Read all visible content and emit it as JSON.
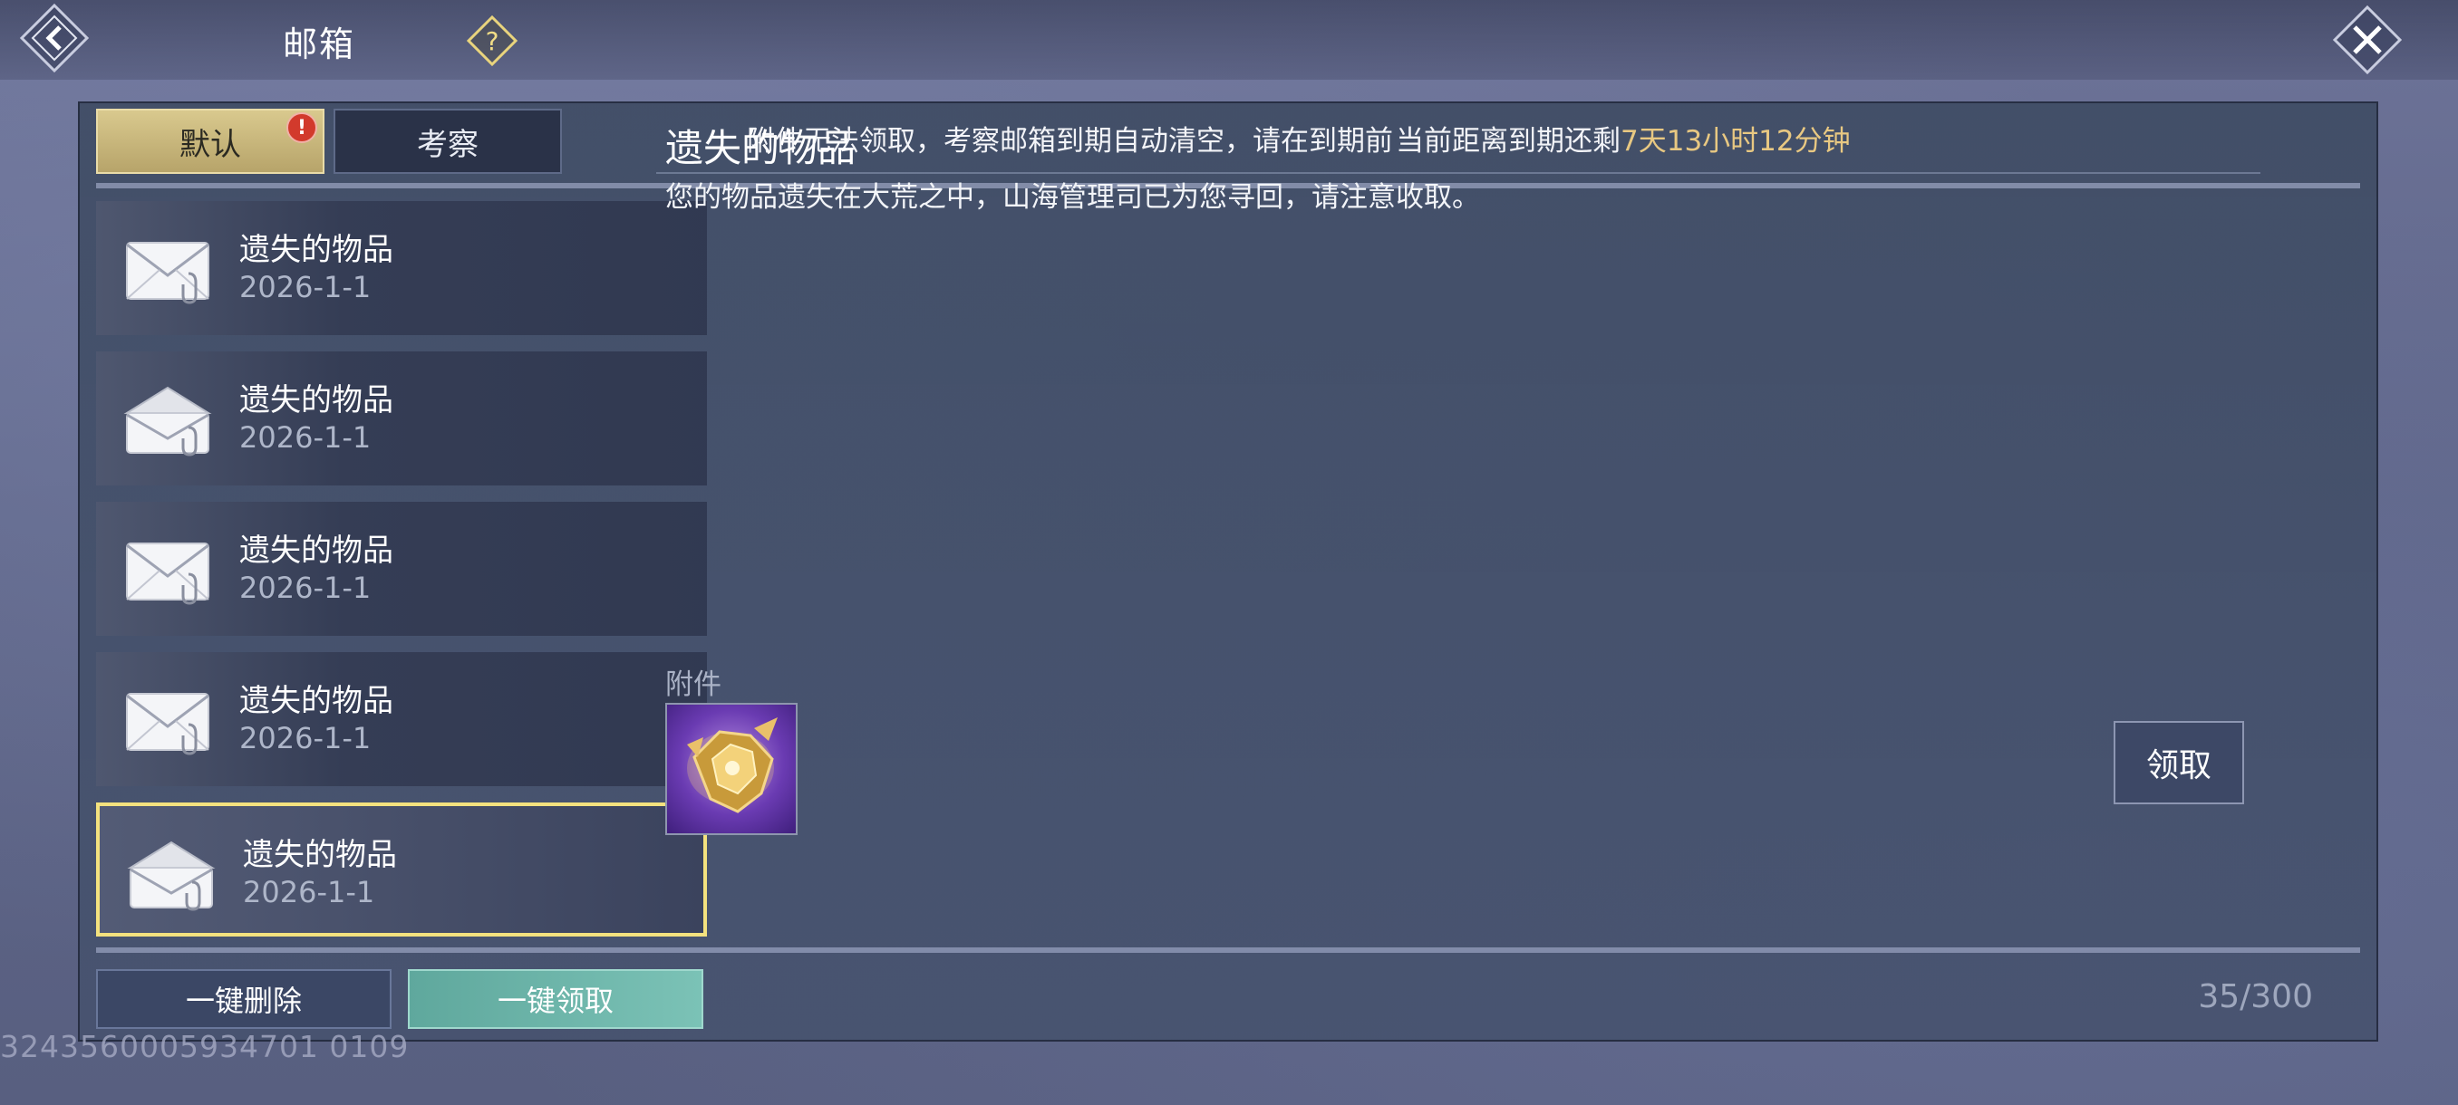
{
  "header": {
    "title": "邮箱",
    "back_icon": "back-arrow-icon",
    "help_icon": "question-mark-icon",
    "close_icon": "close-icon"
  },
  "tabs": [
    {
      "label": "默认",
      "selected": true,
      "badge": "!"
    },
    {
      "label": "考察",
      "selected": false
    }
  ],
  "notice": "附件无法领取，考察邮箱到期自动清空，请在到期前",
  "expiry": {
    "prefix": "当前距离到期还剩",
    "remaining": "7天13小时12分钟"
  },
  "mails": [
    {
      "title": "遗失的物品",
      "date": "2026-1-1",
      "icon": "envelope-closed-icon",
      "selected": false
    },
    {
      "title": "遗失的物品",
      "date": "2026-1-1",
      "icon": "envelope-open-icon",
      "selected": false
    },
    {
      "title": "遗失的物品",
      "date": "2026-1-1",
      "icon": "envelope-closed-icon",
      "selected": false
    },
    {
      "title": "遗失的物品",
      "date": "2026-1-1",
      "icon": "envelope-closed-icon",
      "selected": false
    },
    {
      "title": "遗失的物品",
      "date": "2026-1-1",
      "icon": "envelope-open-icon",
      "selected": true
    }
  ],
  "detail": {
    "title": "遗失的物品",
    "body": "您的物品遗失在大荒之中，山海管理司已为您寻回，请注意收取。",
    "attachment_label": "附件",
    "attachment_icon": "golden-armor-item-icon",
    "claim_label": "领取"
  },
  "footer": {
    "delete_all_label": "一键删除",
    "claim_all_label": "一键领取",
    "count": "35/300"
  },
  "uid": "3243560005934701 0109",
  "colors": {
    "tab_selected": "#d9c98e",
    "highlight_text": "#e8c882",
    "claim_all": "#6fb7ab",
    "selected_border": "#f4e27e",
    "badge": "#d23a2c"
  }
}
